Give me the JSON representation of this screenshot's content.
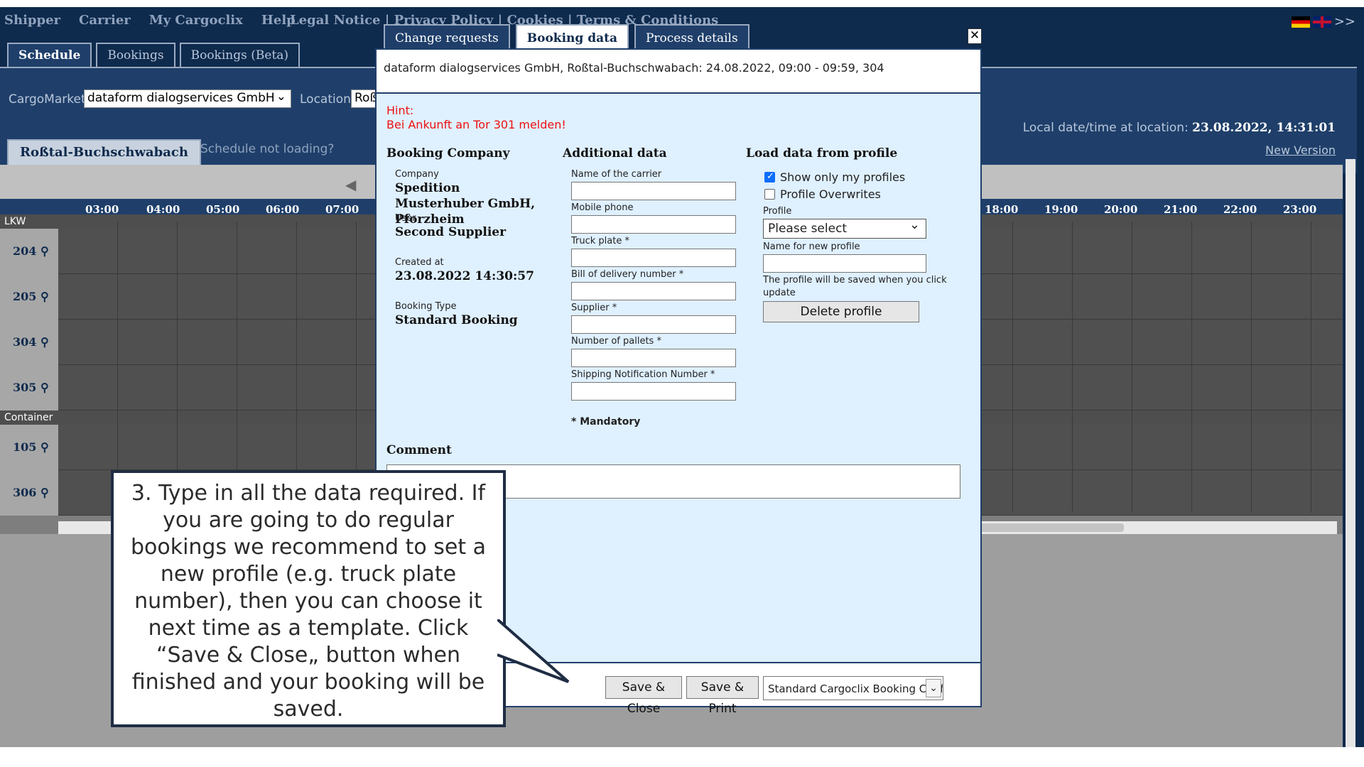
{
  "nav": {
    "items": [
      "Shipper",
      "Carrier",
      "My Cargoclix",
      "Help"
    ],
    "legal": "Legal Notice  |  Privacy Policy  |  Cookies  |  Terms & Conditions",
    "lang_more": ">>"
  },
  "tabs": [
    "Schedule",
    "Bookings",
    "Bookings (Beta)"
  ],
  "filters": {
    "cargomarket_label": "CargoMarket:",
    "cargomarket_value": "dataform dialogservices GmbH",
    "location_label": "Location:",
    "location_value": "Roß",
    "local_time_label": "Local date/time at location:",
    "local_time_value": "23.08.2022, 14:31:01",
    "new_version": "New Version"
  },
  "location_tab": "Roßtal-Buchschwabach",
  "schedule_not_loading": "Schedule not loading?",
  "schedule": {
    "hours_left": [
      "03:00",
      "04:00",
      "05:00",
      "06:00",
      "07:00"
    ],
    "hours_right": [
      "18:00",
      "19:00",
      "20:00",
      "21:00",
      "22:00",
      "23:00"
    ],
    "sections": [
      "LKW",
      "Container"
    ],
    "rows": [
      "204",
      "205",
      "304",
      "305",
      "105",
      "306"
    ]
  },
  "modal": {
    "tabs": [
      "Change requests",
      "Booking data",
      "Process details"
    ],
    "close": "✕",
    "title": "dataform dialogservices GmbH, Roßtal-Buchschwabach: 24.08.2022, 09:00 - 09:59, 304",
    "hint_title": "Hint:",
    "hint_text": "Bei Ankunft an Tor 301 melden!",
    "booking_company": {
      "heading": "Booking Company",
      "company_label": "Company",
      "company_value": "Spedition Musterhuber GmbH, Pforzheim",
      "user_label": "User",
      "user_value": "Second Supplier",
      "created_label": "Created at",
      "created_value": "23.08.2022 14:30:57",
      "type_label": "Booking Type",
      "type_value": "Standard Booking"
    },
    "additional": {
      "heading": "Additional data",
      "fields": [
        "Name of the carrier",
        "Mobile phone",
        "Truck plate *",
        "Bill of delivery number *",
        "Supplier *",
        "Number of pallets *",
        "Shipping Notification Number *"
      ],
      "mandatory": "* Mandatory"
    },
    "profile": {
      "heading": "Load data from profile",
      "show_only_mine": "Show only my profiles",
      "overwrites": "Profile Overwrites",
      "profile_label": "Profile",
      "profile_value": "Please select",
      "new_name_label": "Name for new profile",
      "note": "The profile will be saved when you click update",
      "delete_button": "Delete profile"
    },
    "comment_label": "Comment",
    "footer": {
      "save_close": "Save & Close",
      "save_print": "Save & Print",
      "confirm_select": "Standard Cargoclix Booking Conf"
    }
  },
  "callout": {
    "text": "3. Type in all the data required. If you are going to do regular bookings we recommend to set a new profile (e.g. truck plate number), then you can choose it next time as a template. Click “Save & Close„ button when finished and your booking will be saved."
  },
  "colors": {
    "navy": "#0e2a4d",
    "panel": "#1f3f6a",
    "modal_bg": "#dff0ff",
    "hint_red": "#e11111"
  }
}
